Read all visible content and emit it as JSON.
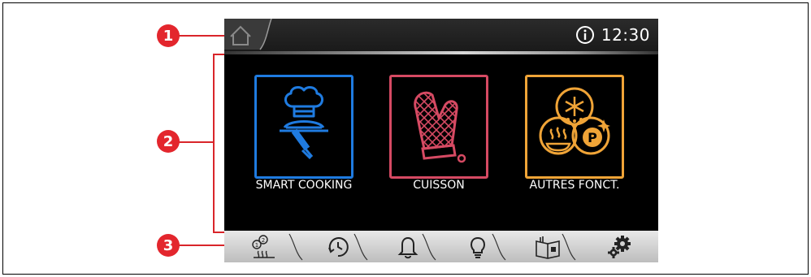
{
  "callouts": [
    "1",
    "2",
    "3"
  ],
  "topbar": {
    "time": "12:30"
  },
  "tiles": [
    {
      "label": "SMART COOKING",
      "color": "#1f7be0",
      "icon": "chef-hat-serving-tray-icon"
    },
    {
      "label": "CUISSON",
      "color": "#d64a63",
      "icon": "oven-mitt-icon"
    },
    {
      "label": "AUTRES FONCT.",
      "color": "#f0a437",
      "icon": "other-functions-icon"
    }
  ],
  "bottom_tabs": [
    {
      "name": "recipe-steps-icon"
    },
    {
      "name": "timer-clock-icon"
    },
    {
      "name": "bell-alarm-icon"
    },
    {
      "name": "light-bulb-icon"
    },
    {
      "name": "recipe-book-icon"
    },
    {
      "name": "settings-gears-icon"
    }
  ]
}
